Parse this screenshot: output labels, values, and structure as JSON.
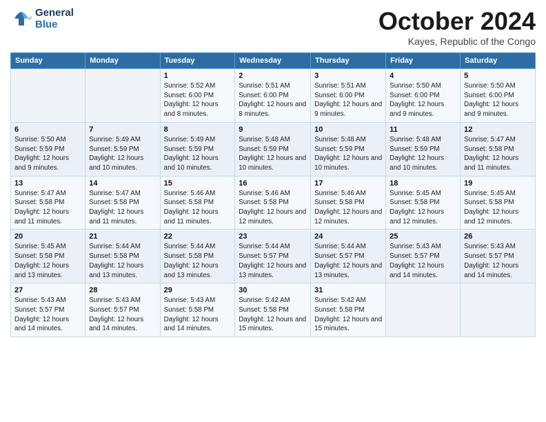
{
  "logo": {
    "line1": "General",
    "line2": "Blue"
  },
  "title": "October 2024",
  "subtitle": "Kayes, Republic of the Congo",
  "days_header": [
    "Sunday",
    "Monday",
    "Tuesday",
    "Wednesday",
    "Thursday",
    "Friday",
    "Saturday"
  ],
  "weeks": [
    [
      {
        "day": "",
        "info": ""
      },
      {
        "day": "",
        "info": ""
      },
      {
        "day": "1",
        "info": "Sunrise: 5:52 AM\nSunset: 6:00 PM\nDaylight: 12 hours and 8 minutes."
      },
      {
        "day": "2",
        "info": "Sunrise: 5:51 AM\nSunset: 6:00 PM\nDaylight: 12 hours and 8 minutes."
      },
      {
        "day": "3",
        "info": "Sunrise: 5:51 AM\nSunset: 6:00 PM\nDaylight: 12 hours and 9 minutes."
      },
      {
        "day": "4",
        "info": "Sunrise: 5:50 AM\nSunset: 6:00 PM\nDaylight: 12 hours and 9 minutes."
      },
      {
        "day": "5",
        "info": "Sunrise: 5:50 AM\nSunset: 6:00 PM\nDaylight: 12 hours and 9 minutes."
      }
    ],
    [
      {
        "day": "6",
        "info": "Sunrise: 5:50 AM\nSunset: 5:59 PM\nDaylight: 12 hours and 9 minutes."
      },
      {
        "day": "7",
        "info": "Sunrise: 5:49 AM\nSunset: 5:59 PM\nDaylight: 12 hours and 10 minutes."
      },
      {
        "day": "8",
        "info": "Sunrise: 5:49 AM\nSunset: 5:59 PM\nDaylight: 12 hours and 10 minutes."
      },
      {
        "day": "9",
        "info": "Sunrise: 5:48 AM\nSunset: 5:59 PM\nDaylight: 12 hours and 10 minutes."
      },
      {
        "day": "10",
        "info": "Sunrise: 5:48 AM\nSunset: 5:59 PM\nDaylight: 12 hours and 10 minutes."
      },
      {
        "day": "11",
        "info": "Sunrise: 5:48 AM\nSunset: 5:59 PM\nDaylight: 12 hours and 10 minutes."
      },
      {
        "day": "12",
        "info": "Sunrise: 5:47 AM\nSunset: 5:58 PM\nDaylight: 12 hours and 11 minutes."
      }
    ],
    [
      {
        "day": "13",
        "info": "Sunrise: 5:47 AM\nSunset: 5:58 PM\nDaylight: 12 hours and 11 minutes."
      },
      {
        "day": "14",
        "info": "Sunrise: 5:47 AM\nSunset: 5:58 PM\nDaylight: 12 hours and 11 minutes."
      },
      {
        "day": "15",
        "info": "Sunrise: 5:46 AM\nSunset: 5:58 PM\nDaylight: 12 hours and 11 minutes."
      },
      {
        "day": "16",
        "info": "Sunrise: 5:46 AM\nSunset: 5:58 PM\nDaylight: 12 hours and 12 minutes."
      },
      {
        "day": "17",
        "info": "Sunrise: 5:46 AM\nSunset: 5:58 PM\nDaylight: 12 hours and 12 minutes."
      },
      {
        "day": "18",
        "info": "Sunrise: 5:45 AM\nSunset: 5:58 PM\nDaylight: 12 hours and 12 minutes."
      },
      {
        "day": "19",
        "info": "Sunrise: 5:45 AM\nSunset: 5:58 PM\nDaylight: 12 hours and 12 minutes."
      }
    ],
    [
      {
        "day": "20",
        "info": "Sunrise: 5:45 AM\nSunset: 5:58 PM\nDaylight: 12 hours and 13 minutes."
      },
      {
        "day": "21",
        "info": "Sunrise: 5:44 AM\nSunset: 5:58 PM\nDaylight: 12 hours and 13 minutes."
      },
      {
        "day": "22",
        "info": "Sunrise: 5:44 AM\nSunset: 5:58 PM\nDaylight: 12 hours and 13 minutes."
      },
      {
        "day": "23",
        "info": "Sunrise: 5:44 AM\nSunset: 5:57 PM\nDaylight: 12 hours and 13 minutes."
      },
      {
        "day": "24",
        "info": "Sunrise: 5:44 AM\nSunset: 5:57 PM\nDaylight: 12 hours and 13 minutes."
      },
      {
        "day": "25",
        "info": "Sunrise: 5:43 AM\nSunset: 5:57 PM\nDaylight: 12 hours and 14 minutes."
      },
      {
        "day": "26",
        "info": "Sunrise: 5:43 AM\nSunset: 5:57 PM\nDaylight: 12 hours and 14 minutes."
      }
    ],
    [
      {
        "day": "27",
        "info": "Sunrise: 5:43 AM\nSunset: 5:57 PM\nDaylight: 12 hours and 14 minutes."
      },
      {
        "day": "28",
        "info": "Sunrise: 5:43 AM\nSunset: 5:57 PM\nDaylight: 12 hours and 14 minutes."
      },
      {
        "day": "29",
        "info": "Sunrise: 5:43 AM\nSunset: 5:58 PM\nDaylight: 12 hours and 14 minutes."
      },
      {
        "day": "30",
        "info": "Sunrise: 5:42 AM\nSunset: 5:58 PM\nDaylight: 12 hours and 15 minutes."
      },
      {
        "day": "31",
        "info": "Sunrise: 5:42 AM\nSunset: 5:58 PM\nDaylight: 12 hours and 15 minutes."
      },
      {
        "day": "",
        "info": ""
      },
      {
        "day": "",
        "info": ""
      }
    ]
  ]
}
